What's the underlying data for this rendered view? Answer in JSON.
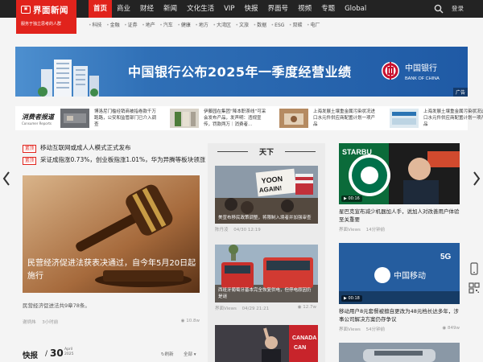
{
  "brand": {
    "name": "界面新闻",
    "slogan": "服务于独立思考的人群"
  },
  "nav": {
    "items": [
      {
        "label": "首页",
        "active": true
      },
      {
        "label": "商业"
      },
      {
        "label": "财经"
      },
      {
        "label": "新闻"
      },
      {
        "label": "文化生活"
      },
      {
        "label": "VIP"
      },
      {
        "label": "快报"
      },
      {
        "label": "界面号"
      },
      {
        "label": "视频"
      },
      {
        "label": "专题"
      },
      {
        "label": "Global"
      }
    ],
    "login": "登录",
    "sub_items": [
      "科技",
      "金融",
      "证券",
      "地产",
      "汽车",
      "健康",
      "地方",
      "大湾区",
      "文旅",
      "数据",
      "ESG",
      "双碳",
      "电厂"
    ]
  },
  "banner": {
    "text": "中国银行公布2025年一季度经营业绩",
    "ad_label": "广告",
    "bank_cn": "中国银行",
    "bank_en": "BANK OF CHINA"
  },
  "strip": {
    "brand": "消费者报道",
    "brand_sub": "Consumer Reports",
    "items": [
      {
        "text": "博洛尼门槛经销商被指卷款千万跑路，公安和监管部门已介入调查"
      },
      {
        "text": "伊藤园在集团“降本职茶线”可采会发布产品，发声明：违规宣传，罚款两万｜消费者..."
      },
      {
        "text": "上海发展土壤重金属污染状况进口水元件供应商配置计划一项产品"
      },
      {
        "text": "上海发展土壤重金属污染状况进口水元件供应商配置计划一项产品"
      }
    ]
  },
  "headlines": [
    {
      "tag": "置顶",
      "text": "移动互联网或成人人模式正式发布"
    },
    {
      "tag": "置顶",
      "text": "采证成指涨0.73%，创业板指涨1.01%，华为异腾等板块领涨"
    }
  ],
  "lead": {
    "caption": "民营经济促进法获表决通过，自今年5月20日起施行",
    "summary": "民营经济促进法共9章78条。",
    "source": "谢炳炜",
    "time": "3小时前",
    "views": "10.8w"
  },
  "flash": {
    "title": "快报",
    "day": "30",
    "month": "April",
    "year": "2025",
    "refresh": "刷新",
    "all": "全部"
  },
  "middle": {
    "title": "天下",
    "cards": [
      {
        "caption": "美宣布移民政策调整，将限制入境者并加强审查",
        "source": "陈丹凌",
        "time": "04/30 12:19",
        "views": ""
      },
      {
        "caption": "西班牙葡萄牙基本完全恢复供电，但停电原因仍是谜",
        "source": "界面Views",
        "time": "04/29 21:21",
        "views": "12.7w"
      },
      {
        "caption": "",
        "source": "",
        "time": "",
        "views": ""
      }
    ]
  },
  "right": {
    "cards": [
      {
        "badge": "00:16",
        "title": "星巴克宣布减少机器加人手，说加人对改善用户体验至关重要",
        "source": "界面Views",
        "time": "14分钟前",
        "views": ""
      },
      {
        "badge": "00:18",
        "title": "移动用户8元套餐被擅自更改为48元档长达多年，涉事公司解决方案仍存争议",
        "source": "界面Views",
        "time": "54分钟前",
        "views": "849w"
      },
      {
        "badge": "",
        "title": "",
        "source": "",
        "time": "",
        "views": ""
      }
    ]
  },
  "colors": {
    "brand_red": "#e1231c",
    "topbar": "#232323"
  }
}
